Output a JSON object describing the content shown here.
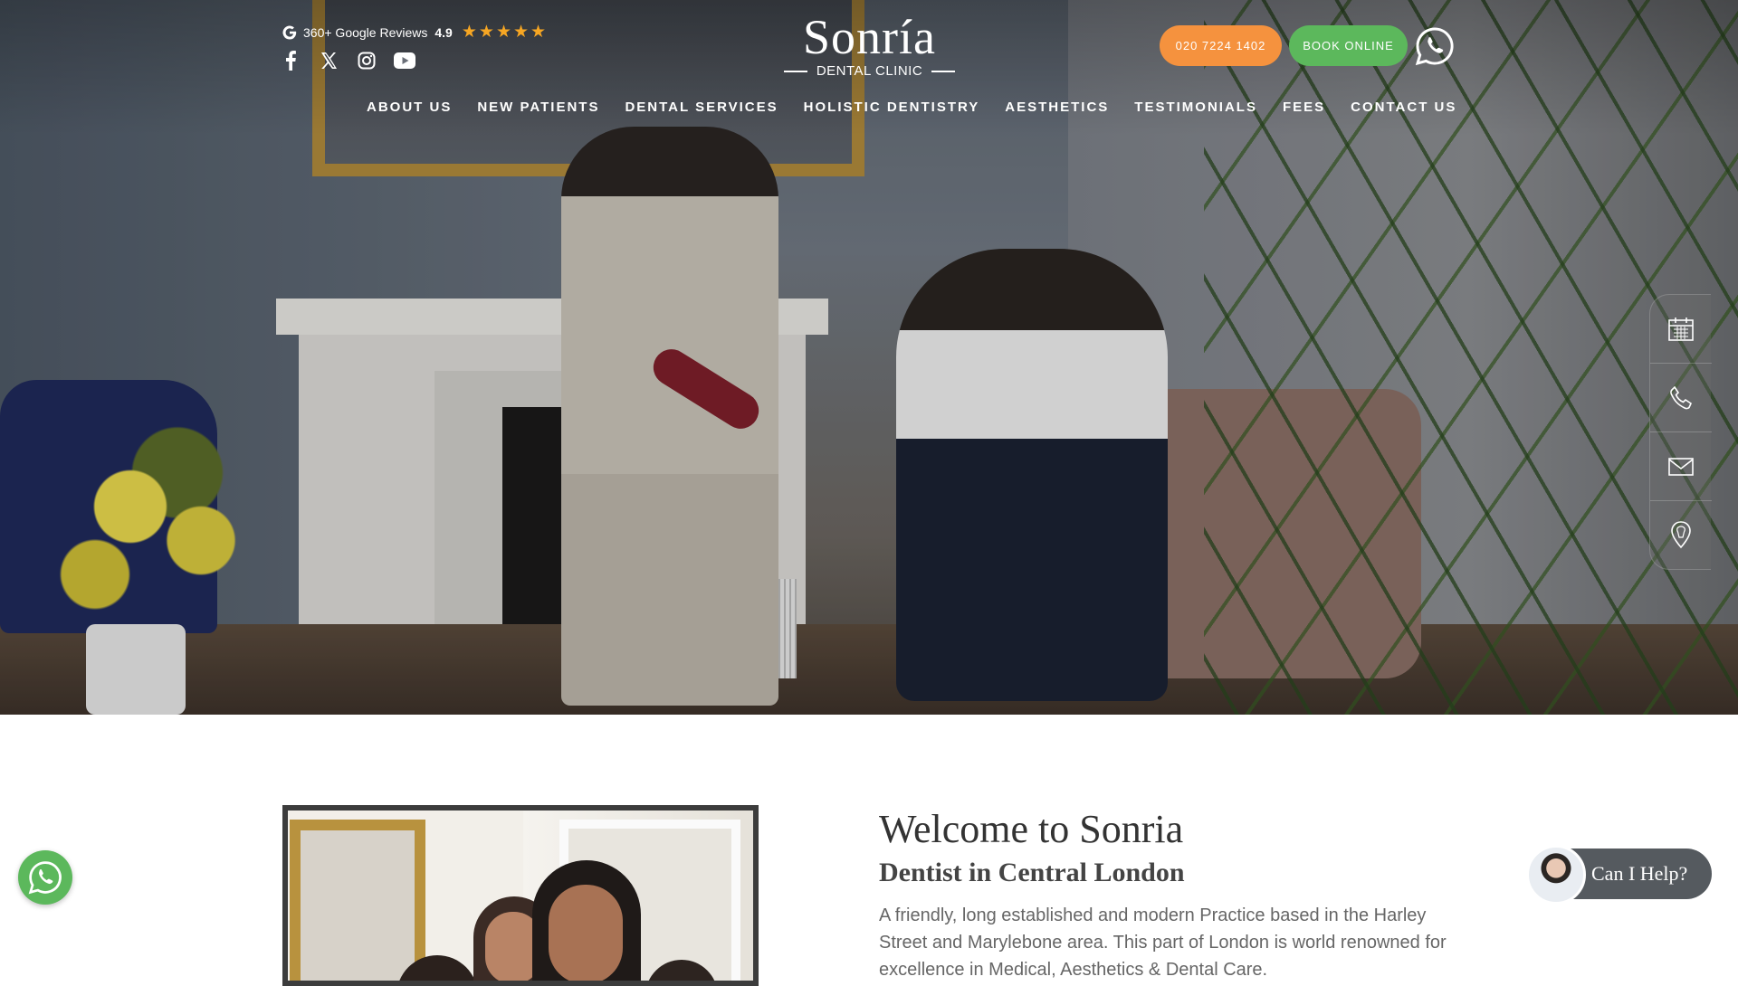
{
  "reviews": {
    "text": "360+ Google Reviews",
    "rating": "4.9",
    "stars": [
      "★",
      "★",
      "★",
      "★",
      "★"
    ]
  },
  "socials": [
    "facebook-icon",
    "x-icon",
    "instagram-icon",
    "youtube-icon"
  ],
  "logo": {
    "main": "Sonría",
    "sub": "DENTAL CLINIC"
  },
  "header_buttons": {
    "phone": "020 7224 1402",
    "book": "BOOK ONLINE"
  },
  "nav": [
    {
      "label": "ABOUT US"
    },
    {
      "label": "NEW PATIENTS"
    },
    {
      "label": "DENTAL SERVICES"
    },
    {
      "label": "HOLISTIC DENTISTRY"
    },
    {
      "label": "AESTHETICS"
    },
    {
      "label": "TESTIMONIALS"
    },
    {
      "label": "FEES"
    },
    {
      "label": "CONTACT US"
    }
  ],
  "dock": [
    "calendar-icon",
    "phone-icon",
    "mail-icon",
    "location-pin-icon"
  ],
  "welcome": {
    "title": "Welcome to Sonria",
    "subtitle": "Dentist in Central London",
    "text": "A friendly, long established and modern Practice based in the Harley Street and Marylebone area. This part of London is world renowned for excellence in Medical, Aesthetics & Dental Care."
  },
  "help_widget": {
    "label": "Can I Help?"
  },
  "colors": {
    "phone_button": "#f5923e",
    "book_button": "#5cb85c",
    "star": "#f6a623",
    "whatsapp": "#5cb85c"
  }
}
